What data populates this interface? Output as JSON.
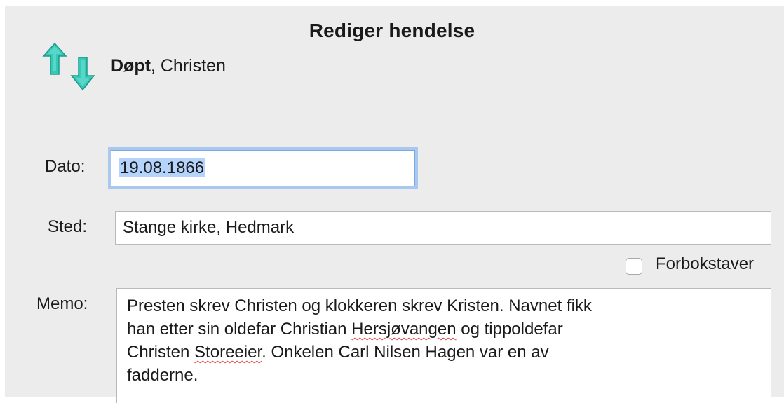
{
  "dialog": {
    "title": "Rediger hendelse"
  },
  "subject": {
    "event": "Døpt",
    "separator": ", ",
    "name": "Christen"
  },
  "icons": {
    "up": "arrow-up-icon",
    "down": "arrow-down-icon",
    "accent": "#2ec4b6"
  },
  "fields": {
    "date": {
      "label": "Dato:",
      "value": "19.08.1866"
    },
    "place": {
      "label": "Sted:",
      "value": "Stange kirke, Hedmark"
    },
    "capitals": {
      "label": "Forbokstaver",
      "checked": false
    },
    "memo": {
      "label": "Memo:",
      "lines": [
        {
          "pre": "Presten skrev Christen og klokkeren skrev Kristen. Navnet fikk",
          "err": "",
          "post": ""
        },
        {
          "pre": "han etter sin oldefar Christian ",
          "err": "Hersjøvangen",
          "post": " og tippoldefar"
        },
        {
          "pre": "Christen ",
          "err": "Storeeier",
          "post": ". Onkelen Carl Nilsen Hagen var en av"
        },
        {
          "pre": "fadderne.",
          "err": "",
          "post": ""
        }
      ]
    }
  }
}
